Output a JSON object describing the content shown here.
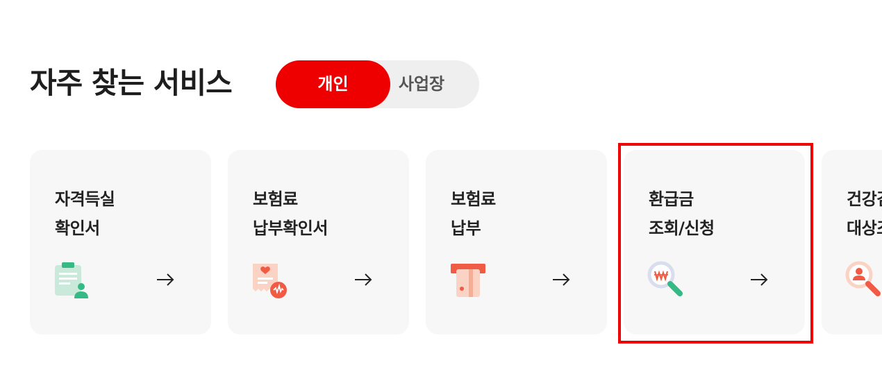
{
  "section": {
    "title": "자주 찾는 서비스"
  },
  "toggle": {
    "personal_label": "개인",
    "business_label": "사업장",
    "selected": "개인"
  },
  "colors": {
    "accent": "#ee0000",
    "card_bg": "#f7f7f7",
    "toggle_bg": "#efefef"
  },
  "cards": [
    {
      "line1": "자격득실",
      "line2": "확인서",
      "icon": "qualification-document-icon"
    },
    {
      "line1": "보험료",
      "line2": "납부확인서",
      "icon": "payment-receipt-icon"
    },
    {
      "line1": "보험료",
      "line2": "납부",
      "icon": "card-payment-icon"
    },
    {
      "line1": "환급금",
      "line2": "조회/신청",
      "icon": "refund-search-icon"
    },
    {
      "line1": "건강검",
      "line2": "대상조",
      "icon": "person-search-icon"
    }
  ]
}
